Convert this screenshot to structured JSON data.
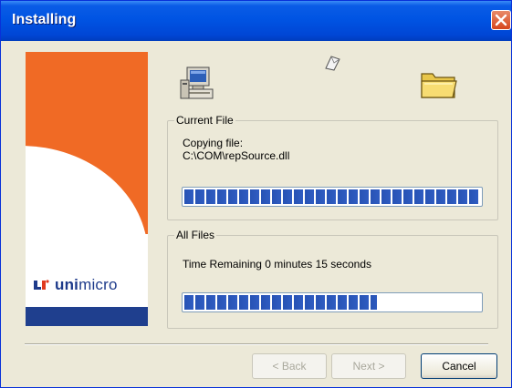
{
  "window": {
    "title": "Installing"
  },
  "branding": {
    "logo_text_bold": "uni",
    "logo_text_rest": "micro"
  },
  "current_file": {
    "group_title": "Current File",
    "line1": "Copying file:",
    "line2": "C:\\COM\\repSource.dll",
    "progress": 1.0
  },
  "all_files": {
    "group_title": "All Files",
    "time_remaining": "Time Remaining 0 minutes 15 seconds",
    "progress": 0.65
  },
  "buttons": {
    "back": "< Back",
    "next": "Next >",
    "cancel": "Cancel"
  },
  "icons": {
    "source": "computer-icon",
    "destination": "folder-icon",
    "transfer": "paper-icon"
  },
  "colors": {
    "brand_orange": "#f06a25",
    "brand_blue": "#1f3f8e",
    "progress_blue": "#2f5cc2"
  }
}
